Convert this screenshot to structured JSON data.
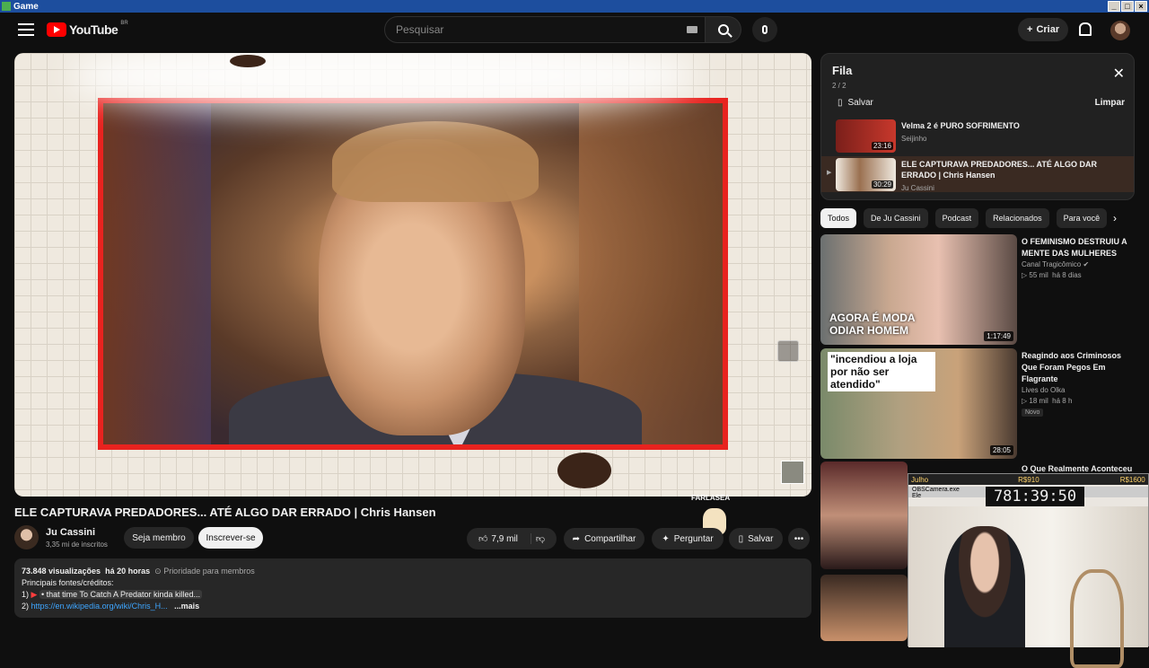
{
  "window": {
    "title": "Game"
  },
  "header": {
    "logo_text": "YouTube",
    "region": "BR",
    "search_placeholder": "Pesquisar",
    "create_label": "Criar"
  },
  "player": {
    "watermark": "FARLASEA"
  },
  "video": {
    "title": "ELE CAPTURAVA PREDADORES... ATÉ ALGO DAR ERRADO | Chris Hansen",
    "channel": "Ju Cassini",
    "subscribers": "3,35 mi de inscritos",
    "member_label": "Seja membro",
    "subscribe_label": "Inscrever-se",
    "likes": "7,9 mil",
    "share_label": "Compartilhar",
    "ask_label": "Perguntar",
    "save_label": "Salvar"
  },
  "description": {
    "views": "73.848 visualizações",
    "age": "há 20 horas",
    "priority": "Prioridade para membros",
    "line1": "Principais fontes/créditos:",
    "line2_prefix": "1)",
    "line2_text": "• that time To Catch A Predator kinda killed...",
    "line3_prefix": "2)",
    "line3_link": "https://en.wikipedia.org/wiki/Chris_H...",
    "more": "...mais"
  },
  "queue": {
    "title": "Fila",
    "count": "2 / 2",
    "save_label": "Salvar",
    "clear_label": "Limpar",
    "items": [
      {
        "title": "Velma 2 é PURO SOFRIMENTO",
        "channel": "Seijinho",
        "duration": "23:16"
      },
      {
        "title": "ELE CAPTURAVA PREDADORES... ATÉ ALGO DAR ERRADO | Chris Hansen",
        "channel": "Ju Cassini",
        "duration": "30:29"
      }
    ]
  },
  "chips": [
    "Todos",
    "De Ju Cassini",
    "Podcast",
    "Relacionados",
    "Para você"
  ],
  "recommendations": [
    {
      "title": "O FEMINISMO DESTRUIU A MENTE DAS MULHERES",
      "channel": "Canal Tragicômico",
      "views": "▷ 55 mil",
      "age": "há 8 dias",
      "duration": "1:17:49",
      "thumb_text": "AGORA É MODA ODIAR HOMEM"
    },
    {
      "title": "Reagindo aos Criminosos Que Foram Pegos Em Flagrante",
      "channel": "Lives do Olka",
      "views": "▷ 18 mil",
      "age": "há 8 h",
      "duration": "28:05",
      "badge": "Novo",
      "thumb_text": "\"incendiou a loja por não ser atendido\""
    },
    {
      "title": "O Que Realmente Aconteceu"
    }
  ],
  "overlay": {
    "user": "Julho",
    "money1": "R$910",
    "money2": "R$1600",
    "cam_label": "OBSCamera.exe",
    "cam_sub": "Ele",
    "timer": "781:39:50"
  }
}
